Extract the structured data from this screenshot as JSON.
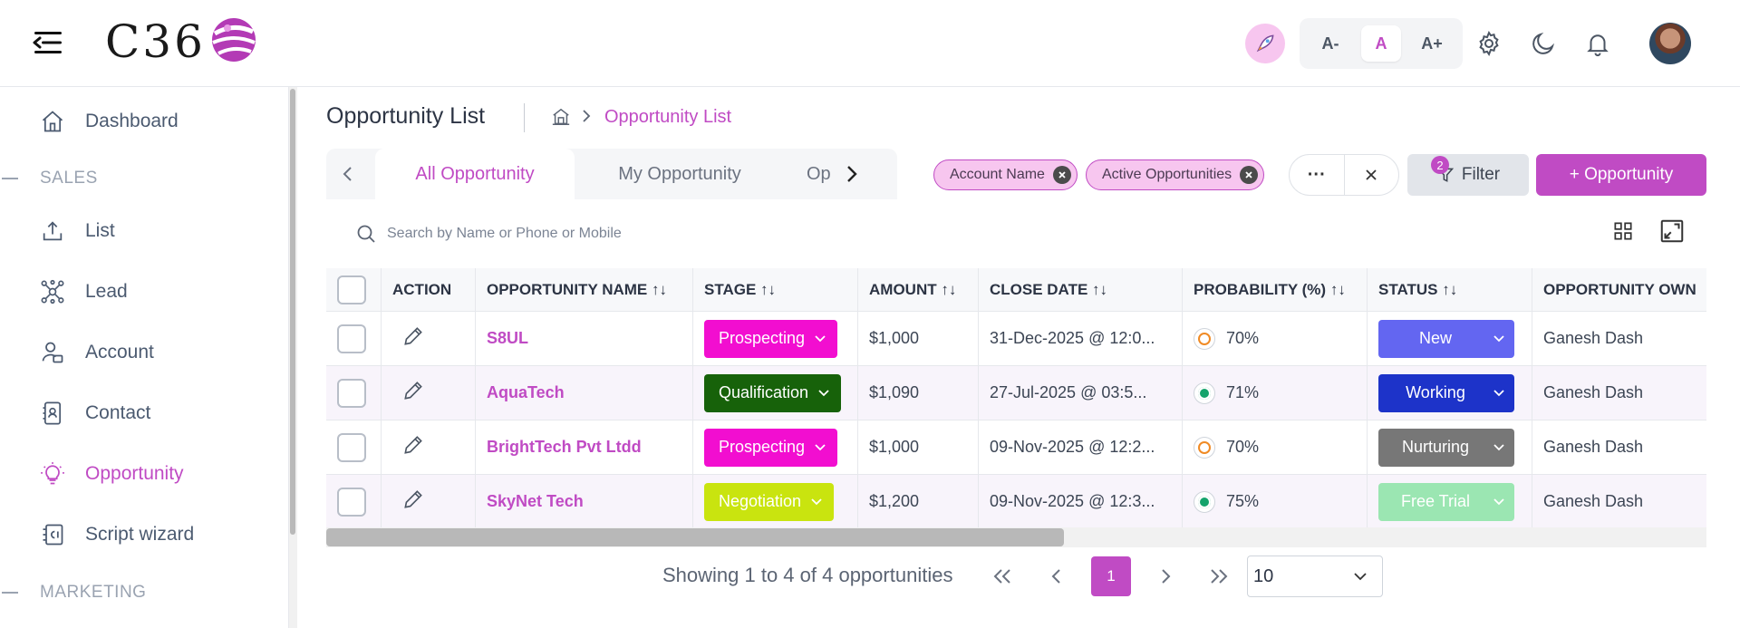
{
  "app": {
    "logo_text": "C36",
    "brand_color": "#c04bc4"
  },
  "header": {
    "font_sizes": [
      "A-",
      "A",
      "A+"
    ],
    "active_font": "A",
    "icons": [
      "hamburger-icon",
      "rocket-icon",
      "gear-icon",
      "moon-icon",
      "bell-icon"
    ]
  },
  "sidebar": {
    "items": [
      {
        "label": "Dashboard",
        "icon": "home-icon"
      },
      {
        "label": "List",
        "icon": "upload-icon"
      },
      {
        "label": "Lead",
        "icon": "network-icon"
      },
      {
        "label": "Account",
        "icon": "user-account-icon"
      },
      {
        "label": "Contact",
        "icon": "contact-card-icon"
      },
      {
        "label": "Opportunity",
        "icon": "lightbulb-icon",
        "active": true
      },
      {
        "label": "Script wizard",
        "icon": "script-icon"
      }
    ],
    "sections": [
      "SALES",
      "MARKETING"
    ]
  },
  "page": {
    "title": "Opportunity List",
    "breadcrumb_current": "Opportunity List"
  },
  "tabs": [
    "All Opportunity",
    "My Opportunity",
    "Op"
  ],
  "active_tab": "All Opportunity",
  "filters": {
    "chips": [
      "Account Name",
      "Active Opportunities"
    ],
    "filter_label": "Filter",
    "filter_count": "2",
    "add_label": "+ Opportunity",
    "more_label": "···"
  },
  "search": {
    "placeholder": "Search by Name or Phone or Mobile"
  },
  "table": {
    "columns": [
      "ACTION",
      "OPPORTUNITY NAME",
      "STAGE",
      "AMOUNT",
      "CLOSE DATE",
      "PROBABILITY (%)",
      "STATUS",
      "OPPORTUNITY OWN"
    ],
    "sort_glyph": "↑↓",
    "rows": [
      {
        "name": "S8UL",
        "stage": "Prospecting",
        "stage_color": "#f20ed0",
        "amount": "$1,000",
        "close_date": "31-Dec-2025 @ 12:0...",
        "probability": "70%",
        "prob_color": "#f08a24",
        "status": "New",
        "status_color": "#6366f1",
        "owner": "Ganesh Dash"
      },
      {
        "name": "AquaTech",
        "stage": "Qualification",
        "stage_color": "#17620a",
        "amount": "$1,090",
        "close_date": "27-Jul-2025 @ 03:5...",
        "probability": "71%",
        "prob_color": "#14a36b",
        "status": "Working",
        "status_color": "#1d33c9",
        "owner": "Ganesh Dash"
      },
      {
        "name": "BrightTech Pvt Ltdd",
        "stage": "Prospecting",
        "stage_color": "#f20ed0",
        "amount": "$1,000",
        "close_date": "09-Nov-2025 @ 12:2...",
        "probability": "70%",
        "prob_color": "#f08a24",
        "status": "Nurturing",
        "status_color": "#777777",
        "owner": "Ganesh Dash"
      },
      {
        "name": "SkyNet Tech",
        "stage": "Negotiation",
        "stage_color": "#c9e40f",
        "amount": "$1,200",
        "close_date": "09-Nov-2025 @ 12:3...",
        "probability": "75%",
        "prob_color": "#14a36b",
        "status": "Free Trial",
        "status_color": "#9be6b2",
        "owner": "Ganesh Dash"
      }
    ]
  },
  "pagination": {
    "summary": "Showing 1 to 4 of 4 opportunities",
    "current_page": "1",
    "page_size": "10"
  }
}
